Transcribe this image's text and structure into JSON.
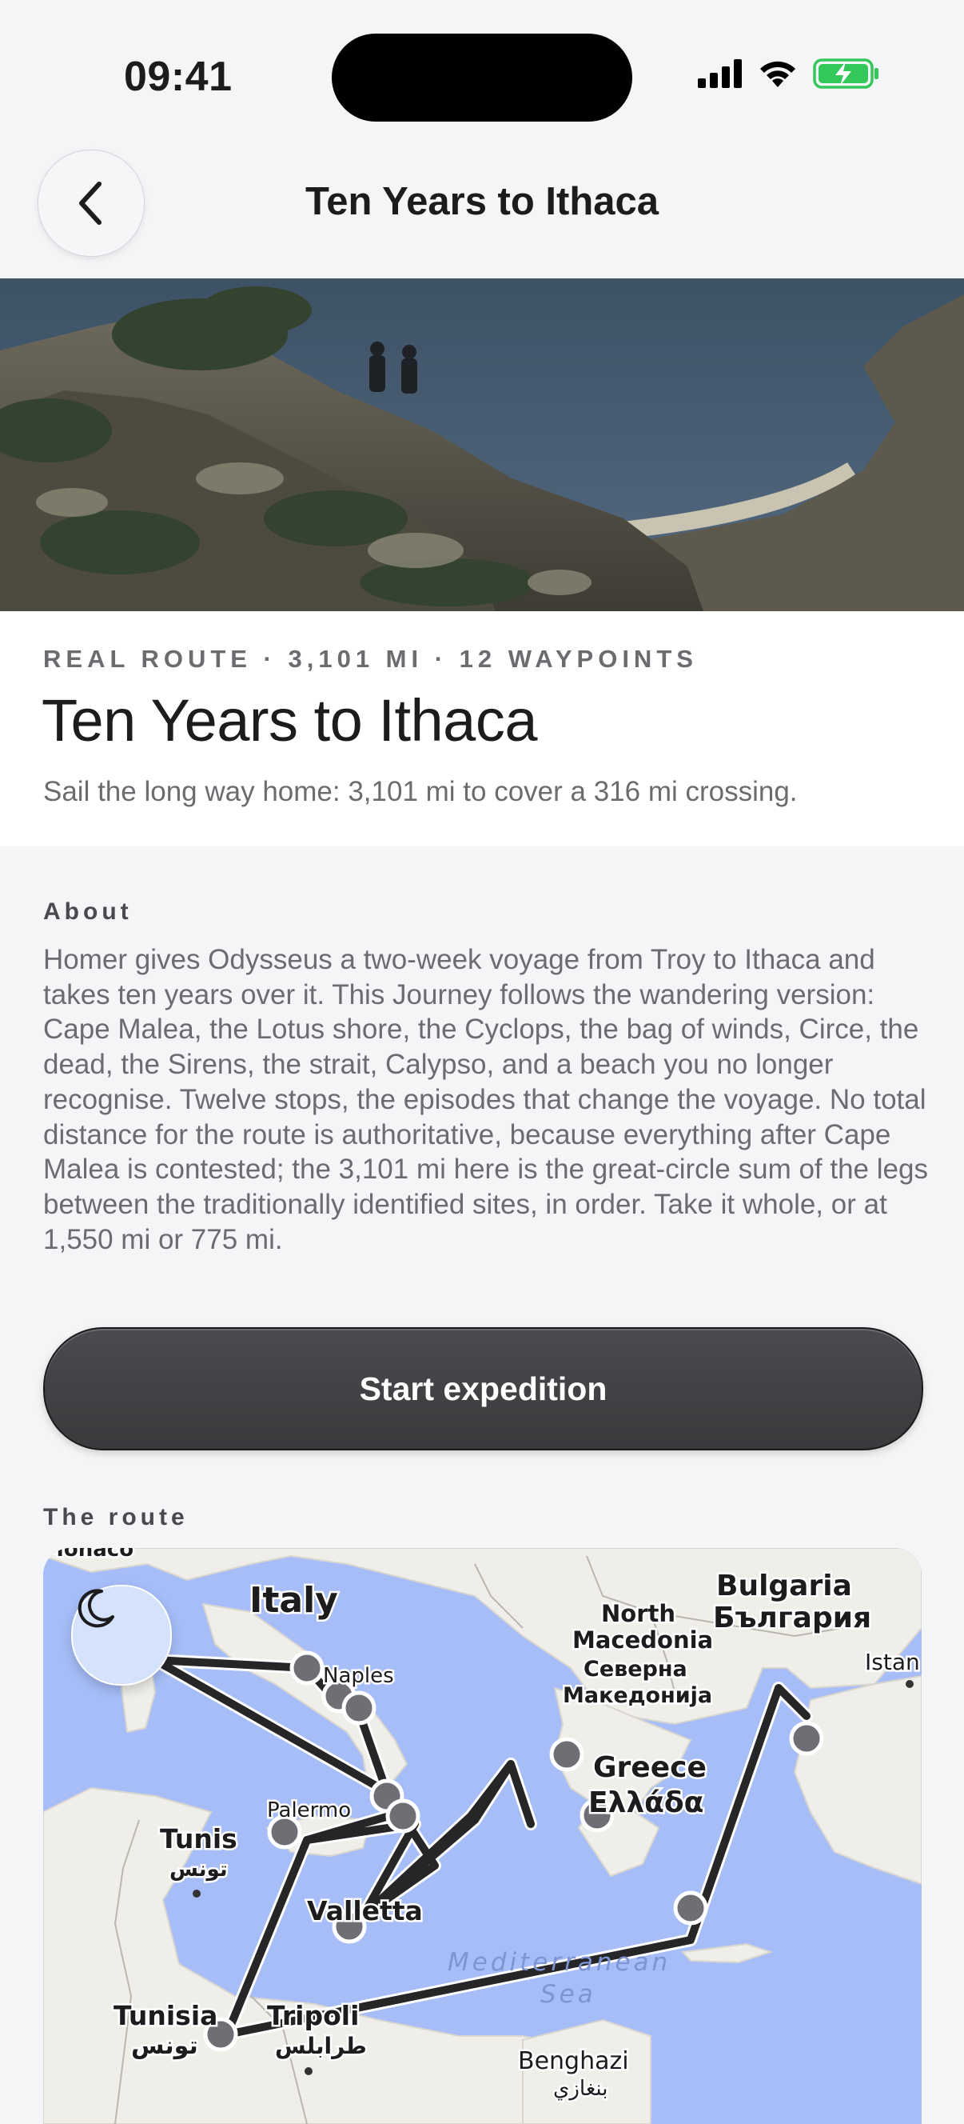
{
  "status_bar": {
    "time": "09:41",
    "icons": [
      "signal-icon",
      "wifi-icon",
      "battery-charging-icon"
    ],
    "battery_color": "#34c759"
  },
  "nav": {
    "title": "Ten Years to Ithaca",
    "back_icon": "chevron-left-icon"
  },
  "hero": {
    "image": "coastal-cliff-photo"
  },
  "header": {
    "meta": "REAL ROUTE · 3,101 MI · 12 WAYPOINTS",
    "title": "Ten Years to Ithaca",
    "subtitle": "Sail the long way home: 3,101 mi to cover a 316 mi crossing."
  },
  "about": {
    "label": "About",
    "text": "Homer gives Odysseus a two-week voyage from Troy to Ithaca and takes ten years over it. This Journey follows the wandering version: Cape Malea, the Lotus shore, the Cyclops, the bag of winds, Circe, the dead, the Sirens, the strait, Calypso, and a beach you no longer recognise. Twelve stops, the episodes that change the voyage. No total distance for the route is authoritative, because everything after Cape Malea is contested; the 3,101 mi here is the great-circle sum of the legs between the traditionally identified sites, in order. Take it whole, or at 1,550 mi or 775 mi."
  },
  "actions": {
    "start_label": "Start expedition"
  },
  "route": {
    "label": "The route",
    "theme_icon": "moon-icon",
    "map_labels": {
      "monaco": "Monaco",
      "italy": "Italy",
      "naples": "Naples",
      "north_macedonia_en": "North",
      "north_macedonia_en2": "Macedonia",
      "north_macedonia_local1": "Северна",
      "north_macedonia_local2": "Македонија",
      "bulgaria_en": "Bulgaria",
      "bulgaria_local": "България",
      "istanbul": "Istan",
      "greece_en": "Greece",
      "greece_local": "Ελλάδα",
      "palermo": "Palermo",
      "tunis": "Tunis",
      "tunis_local": "تونس",
      "valletta": "Valletta",
      "tunisia": "Tunisia",
      "tunisia_local": "تونس",
      "tripoli": "Tripoli",
      "tripoli_local": "طرابلس",
      "sea_1": "Mediterranean",
      "sea_2": "Sea",
      "benghazi": "Benghazi",
      "benghazi_local": "بنغازي"
    },
    "colors": {
      "water": "#a6bdf8",
      "land": "#efeee9",
      "route": "#262628",
      "waypoint": "#6e6f75"
    }
  }
}
